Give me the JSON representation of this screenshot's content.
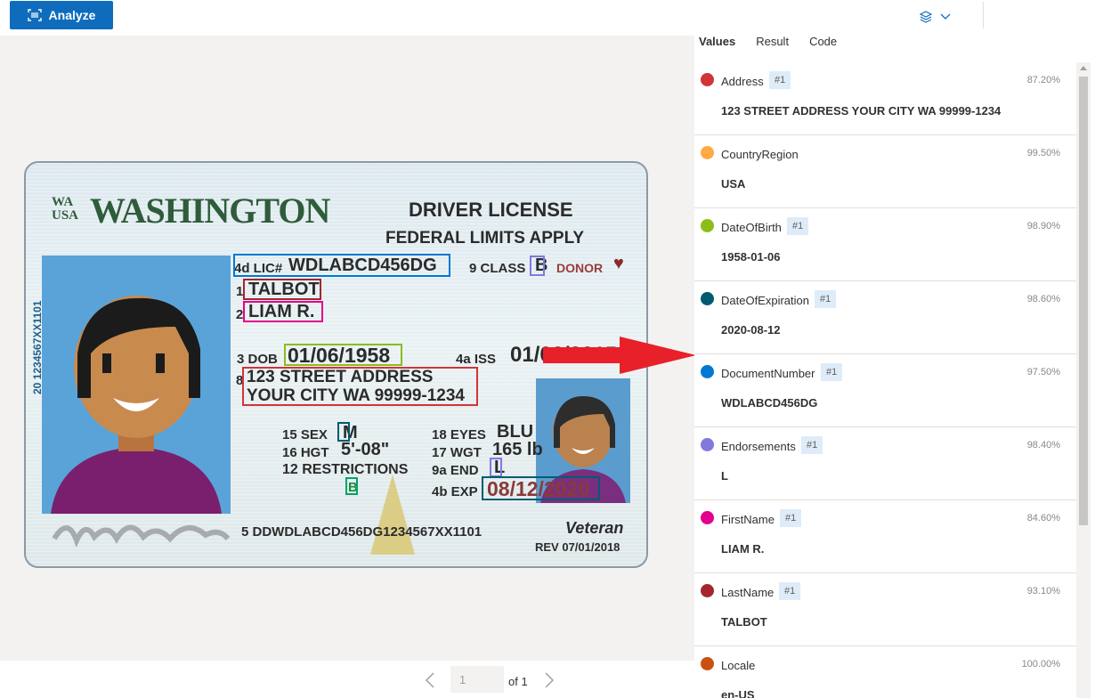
{
  "toolbar": {
    "analyze_label": "Analyze"
  },
  "pager": {
    "page_value": "1",
    "of_label": "of 1"
  },
  "card": {
    "state_abbr": "WA\nUSA",
    "state_name": "WASHINGTON",
    "doc_title": "DRIVER LICENSE",
    "doc_subtitle": "FEDERAL LIMITS APPLY",
    "vertical_number": "20 1234567XX1101",
    "lic_label": "4d LIC#",
    "lic_value": "WDLABCD456DG",
    "class_label": "9 CLASS",
    "class_value": "B",
    "donor_label": "DONOR",
    "last_label": "1",
    "last_value": "TALBOT",
    "first_label": "2",
    "first_value": "LIAM R.",
    "dob_label": "3 DOB",
    "dob_value": "01/06/1958",
    "iss_label": "4a ISS",
    "iss_value": "01/06/2015",
    "addr_label": "8",
    "addr_line1": "123 STREET ADDRESS",
    "addr_line2": "YOUR CITY WA 99999-1234",
    "sex_label": "15 SEX",
    "sex_value": "M",
    "eyes_label": "18 EYES",
    "eyes_value": "BLU",
    "hgt_label": "16 HGT",
    "hgt_value": "5'-08\"",
    "wgt_label": "17 WGT",
    "wgt_value": "165 lb",
    "restr_label": "12 RESTRICTIONS",
    "restr_value": "B",
    "end_label": "9a END",
    "end_value": "L",
    "exp_label": "4b EXP",
    "exp_value": "08/12/2020",
    "dd_value": "5 DDWDLABCD456DG1234567XX1101",
    "veteran": "Veteran",
    "rev": "REV 07/01/2018"
  },
  "panel": {
    "tabs": [
      {
        "label": "Values",
        "active": true
      },
      {
        "label": "Result",
        "active": false
      },
      {
        "label": "Code",
        "active": false
      }
    ],
    "fields": [
      {
        "name": "Address",
        "badge": "#1",
        "confidence": "87.20%",
        "value": "123 STREET ADDRESS YOUR CITY WA 99999-1234",
        "color": "#d13438"
      },
      {
        "name": "CountryRegion",
        "badge": "",
        "confidence": "99.50%",
        "value": "USA",
        "color": "#ffaa44"
      },
      {
        "name": "DateOfBirth",
        "badge": "#1",
        "confidence": "98.90%",
        "value": "1958-01-06",
        "color": "#8cbd18"
      },
      {
        "name": "DateOfExpiration",
        "badge": "#1",
        "confidence": "98.60%",
        "value": "2020-08-12",
        "color": "#005b70"
      },
      {
        "name": "DocumentNumber",
        "badge": "#1",
        "confidence": "97.50%",
        "value": "WDLABCD456DG",
        "color": "#0078d4"
      },
      {
        "name": "Endorsements",
        "badge": "#1",
        "confidence": "98.40%",
        "value": "L",
        "color": "#8378de"
      },
      {
        "name": "FirstName",
        "badge": "#1",
        "confidence": "84.60%",
        "value": "LIAM R.",
        "color": "#e3008c"
      },
      {
        "name": "LastName",
        "badge": "#1",
        "confidence": "93.10%",
        "value": "TALBOT",
        "color": "#a4262c"
      },
      {
        "name": "Locale",
        "badge": "",
        "confidence": "100.00%",
        "value": "en-US",
        "color": "#ca5010"
      }
    ]
  }
}
